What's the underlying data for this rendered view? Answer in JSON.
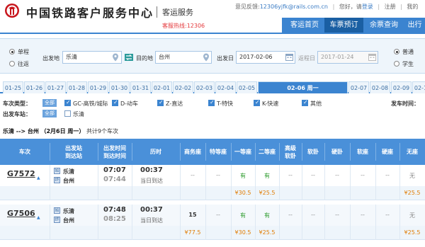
{
  "header": {
    "title": "中国铁路客户服务中心",
    "service": "客运服务",
    "hotline": "客服热线:12306",
    "feedback_label": "意见反馈:",
    "feedback_email": "12306yjfk@rails.com.cn",
    "greeting": "您好，请",
    "login": "登录",
    "register": "注册",
    "my": "我的"
  },
  "nav": [
    {
      "label": "客运首页"
    },
    {
      "label": "车票预订"
    },
    {
      "label": "余票查询"
    },
    {
      "label": "出行"
    }
  ],
  "search": {
    "trip_types": [
      "单程",
      "往返"
    ],
    "from_label": "出发地",
    "from_value": "乐清",
    "to_label": "目的地",
    "to_value": "台州",
    "date_label": "出发日",
    "date_value": "2017-02-06",
    "return_label": "返程日",
    "return_value": "2017-01-24",
    "passenger_types": [
      "普通",
      "学生"
    ]
  },
  "dates": [
    "01-25",
    "01-26",
    "01-27",
    "01-28",
    "01-29",
    "01-30",
    "01-31",
    "02-01",
    "02-02",
    "02-03",
    "02-04",
    "02-05",
    "02-06 周一",
    "02-07",
    "02-08",
    "02-09",
    "02-10"
  ],
  "filters": {
    "train_type_label": "车次类型：",
    "all": "全部",
    "types": [
      "GC-高铁/城际",
      "D-动车",
      "Z-直达",
      "T-特快",
      "K-快速",
      "其他"
    ],
    "depart_station_label": "出发车站：",
    "depart_stations": [
      "乐清"
    ],
    "depart_time_label": "发车时间："
  },
  "result_summary": {
    "route": "乐清 --> 台州",
    "date": "（2月6日 周一）",
    "count_text": "共计9个车次"
  },
  "table": {
    "headers": {
      "train": "车次",
      "stations": [
        "出发站",
        "到达站"
      ],
      "times": [
        "出发时间",
        "到达时间"
      ],
      "duration": "历时",
      "business": "商务座",
      "special": "特等座",
      "first": "一等座",
      "second": "二等座",
      "deluxe_soft": [
        "高级",
        "软卧"
      ],
      "soft_sleeper": "软卧",
      "hard_sleeper": "硬卧",
      "soft_seat": "软座",
      "hard_seat": "硬座",
      "no_seat": "无座"
    },
    "rows": [
      {
        "train": "G7572",
        "from": "乐清",
        "to": "台州",
        "depart": "07:07",
        "arrive": "07:44",
        "duration": "00:37",
        "duration_note": "当日到达",
        "business": "--",
        "special": "--",
        "first": "有",
        "second": "有",
        "deluxe_soft": "--",
        "soft_sleeper": "--",
        "hard_sleeper": "--",
        "soft_seat": "--",
        "hard_seat": "--",
        "no_seat": "无",
        "prices": {
          "first": "¥30.5",
          "second": "¥25.5",
          "no_seat": "¥25.5"
        }
      },
      {
        "train": "G7506",
        "from": "乐清",
        "to": "台州",
        "depart": "07:48",
        "arrive": "08:25",
        "duration": "00:37",
        "duration_note": "当日到达",
        "business": "15",
        "special": "--",
        "first": "有",
        "second": "有",
        "deluxe_soft": "--",
        "soft_sleeper": "--",
        "hard_sleeper": "--",
        "soft_seat": "--",
        "hard_seat": "--",
        "no_seat": "无",
        "prices": {
          "business": "¥77.5",
          "first": "¥30.5",
          "second": "¥25.5",
          "no_seat": "¥25.5"
        }
      }
    ]
  },
  "colors": {
    "primary": "#3b84d0",
    "nav_active": "#1a5fa3",
    "available": "#2a9a2a",
    "price": "#e07b00",
    "hotline": "#e4393c"
  }
}
